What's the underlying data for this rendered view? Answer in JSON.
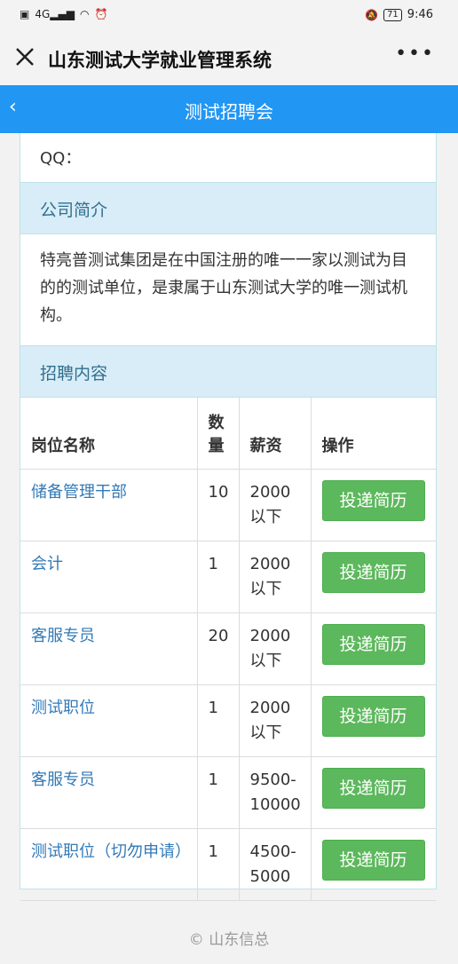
{
  "status": {
    "left_icons": [
      "hd-icon",
      "signal-4g-icon",
      "wifi-icon",
      "alarm-icon"
    ],
    "network": "4G",
    "battery": "71",
    "time": "9:46"
  },
  "wechat": {
    "title": "山东测试大学就业管理系统",
    "more": "•••"
  },
  "nav": {
    "back": "‹",
    "title": "测试招聘会"
  },
  "card": {
    "qq_label": "QQ：",
    "intro_header": "公司简介",
    "intro_text": "特亮普测试集团是在中国注册的唯一一家以测试为目的的测试单位，是隶属于山东测试大学的唯一测试机构。",
    "jobs_header": "招聘内容"
  },
  "jobs_table": {
    "headers": [
      "岗位名称",
      "数量",
      "薪资",
      "操作"
    ],
    "rows": [
      {
        "name": "储备管理干部",
        "count": "10",
        "salary": "2000以下",
        "action": "投递简历"
      },
      {
        "name": "会计",
        "count": "1",
        "salary": "2000以下",
        "action": "投递简历"
      },
      {
        "name": "客服专员",
        "count": "20",
        "salary": "2000以下",
        "action": "投递简历"
      },
      {
        "name": "测试职位",
        "count": "1",
        "salary": "2000以下",
        "action": "投递简历"
      },
      {
        "name": "客服专员",
        "count": "1",
        "salary": "9500-10000",
        "action": "投递简历"
      },
      {
        "name": "测试职位（切勿申请）",
        "count": "1",
        "salary": "4500-5000",
        "action": "投递简历"
      }
    ]
  },
  "footer": "© 山东信总",
  "colors": {
    "nav_bg": "#2196f3",
    "section_bg": "#d8edf7",
    "section_text": "#31708f",
    "link": "#337ab7",
    "button": "#5cb85c"
  }
}
